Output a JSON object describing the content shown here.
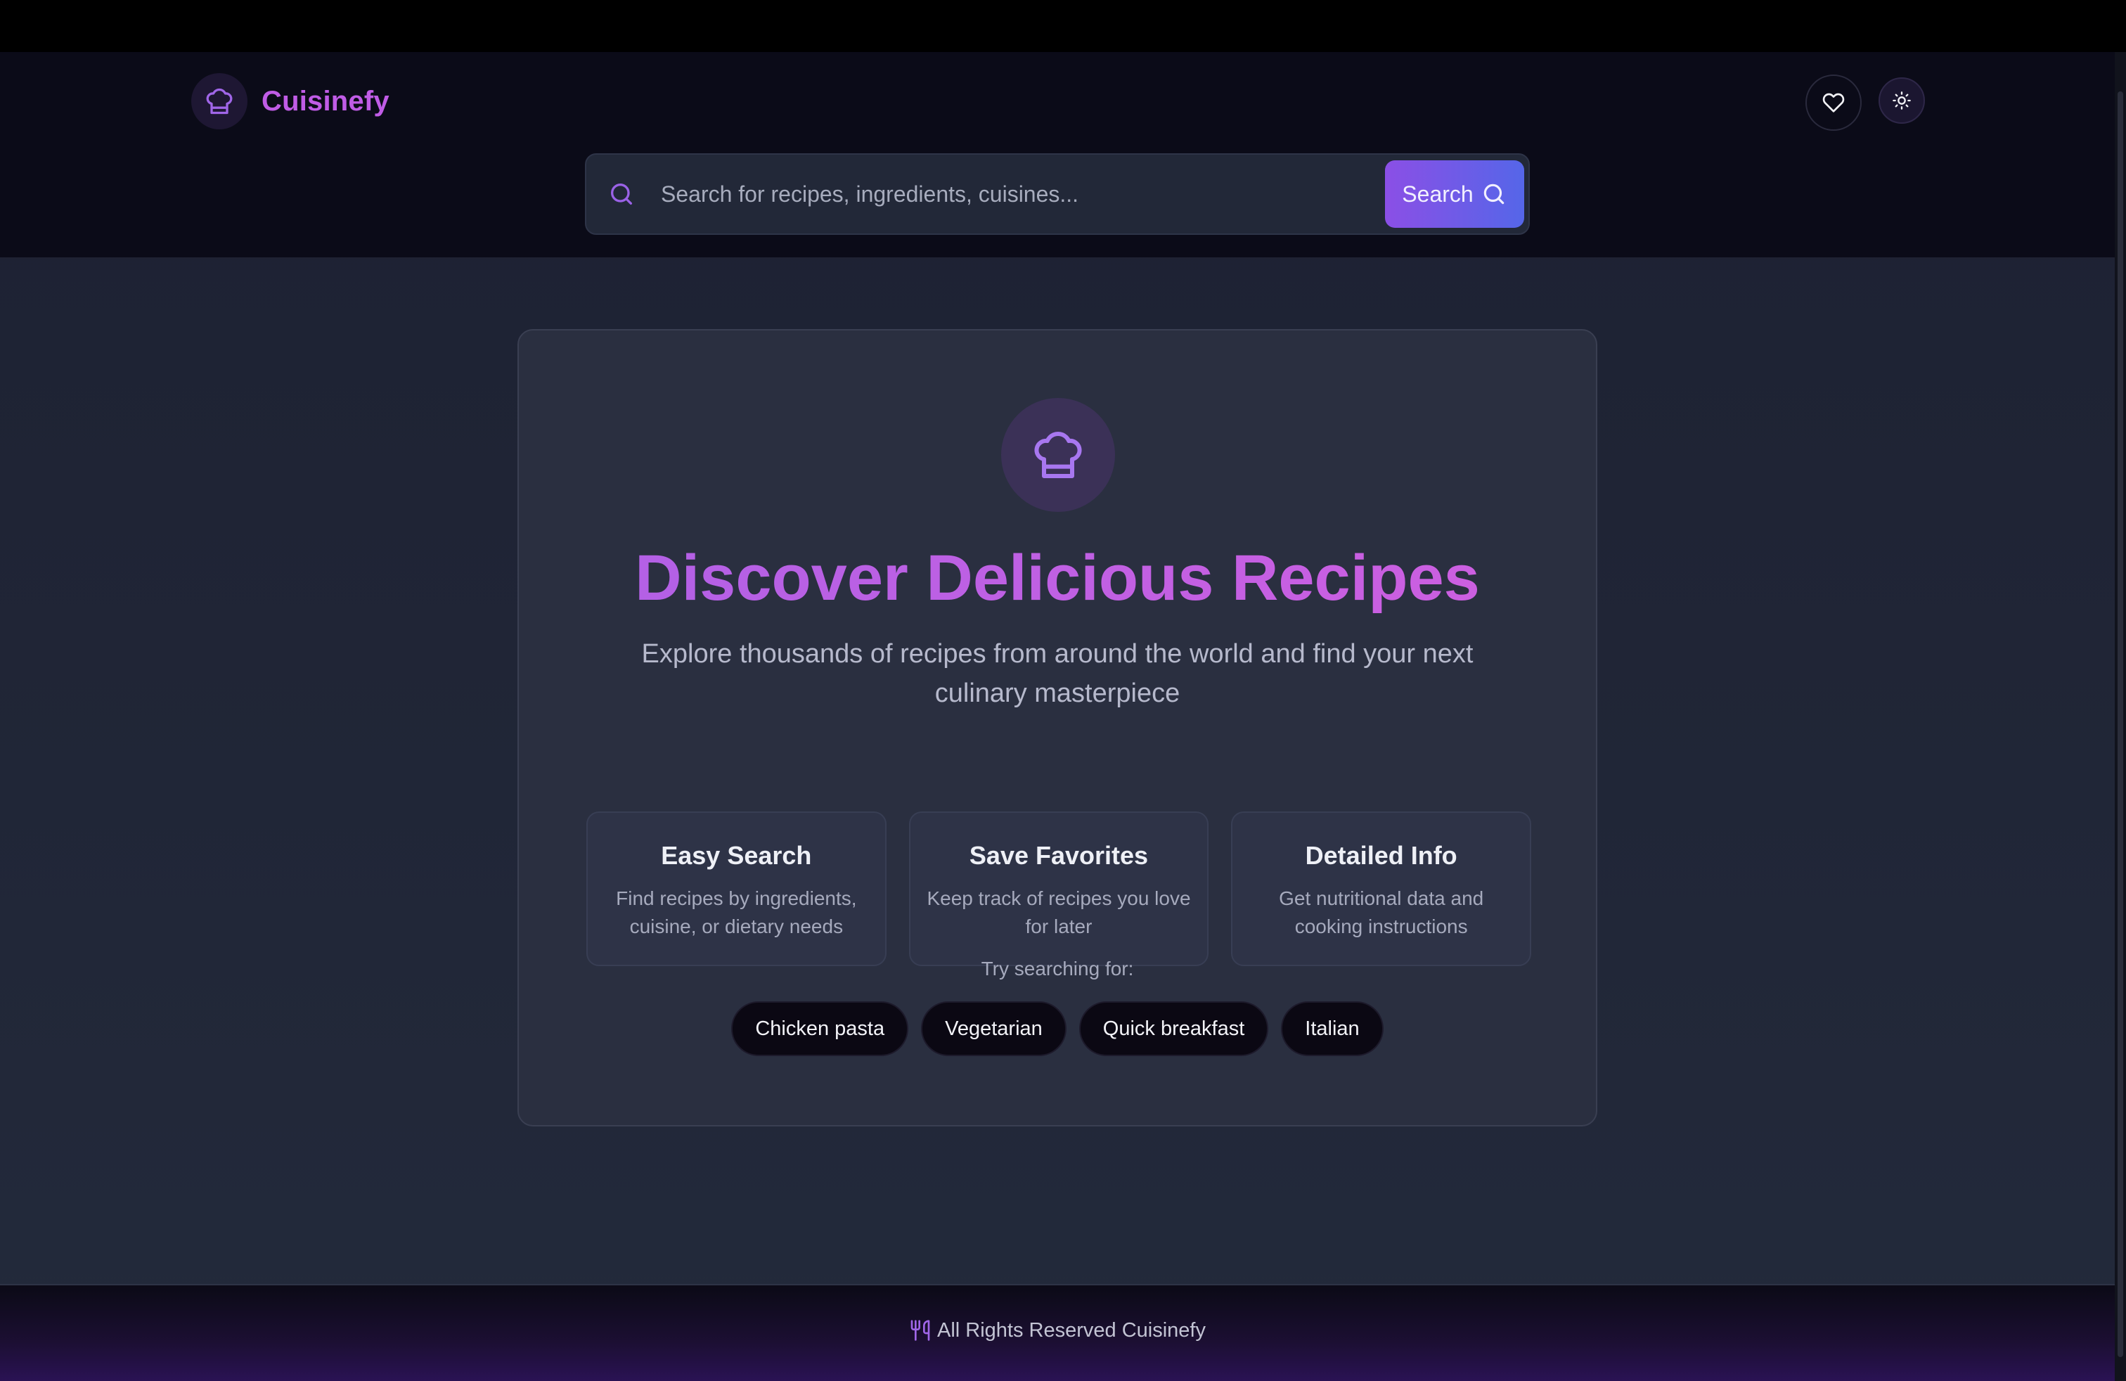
{
  "brand": {
    "name": "Cuisinefy",
    "icon": "chef-hat-icon"
  },
  "header_actions": {
    "favorites_icon": "heart-icon",
    "theme_icon": "sun-icon"
  },
  "search": {
    "placeholder": "Search for recipes, ingredients, cuisines...",
    "value": "",
    "button_label": "Search"
  },
  "hero": {
    "icon": "chef-hat-icon",
    "title": "Discover Delicious Recipes",
    "subtitle": "Explore thousands of recipes from around the world and find your next culinary masterpiece"
  },
  "features": [
    {
      "title": "Easy Search",
      "description": "Find recipes by ingredients, cuisine, or dietary needs"
    },
    {
      "title": "Save Favorites",
      "description": "Keep track of recipes you love for later"
    },
    {
      "title": "Detailed Info",
      "description": "Get nutritional data and cooking instructions"
    }
  ],
  "suggestions": {
    "label": "Try searching for:",
    "items": [
      "Chicken pasta",
      "Vegetarian",
      "Quick breakfast",
      "Italian"
    ]
  },
  "footer": {
    "icon": "utensils-icon",
    "text": "All Rights Reserved Cuisinefy"
  },
  "colors": {
    "accent": "#c05ce6",
    "button_gradient_start": "#8b4fe6",
    "button_gradient_end": "#5566e8",
    "background": "#1d2132",
    "card": "#2a2f40"
  }
}
